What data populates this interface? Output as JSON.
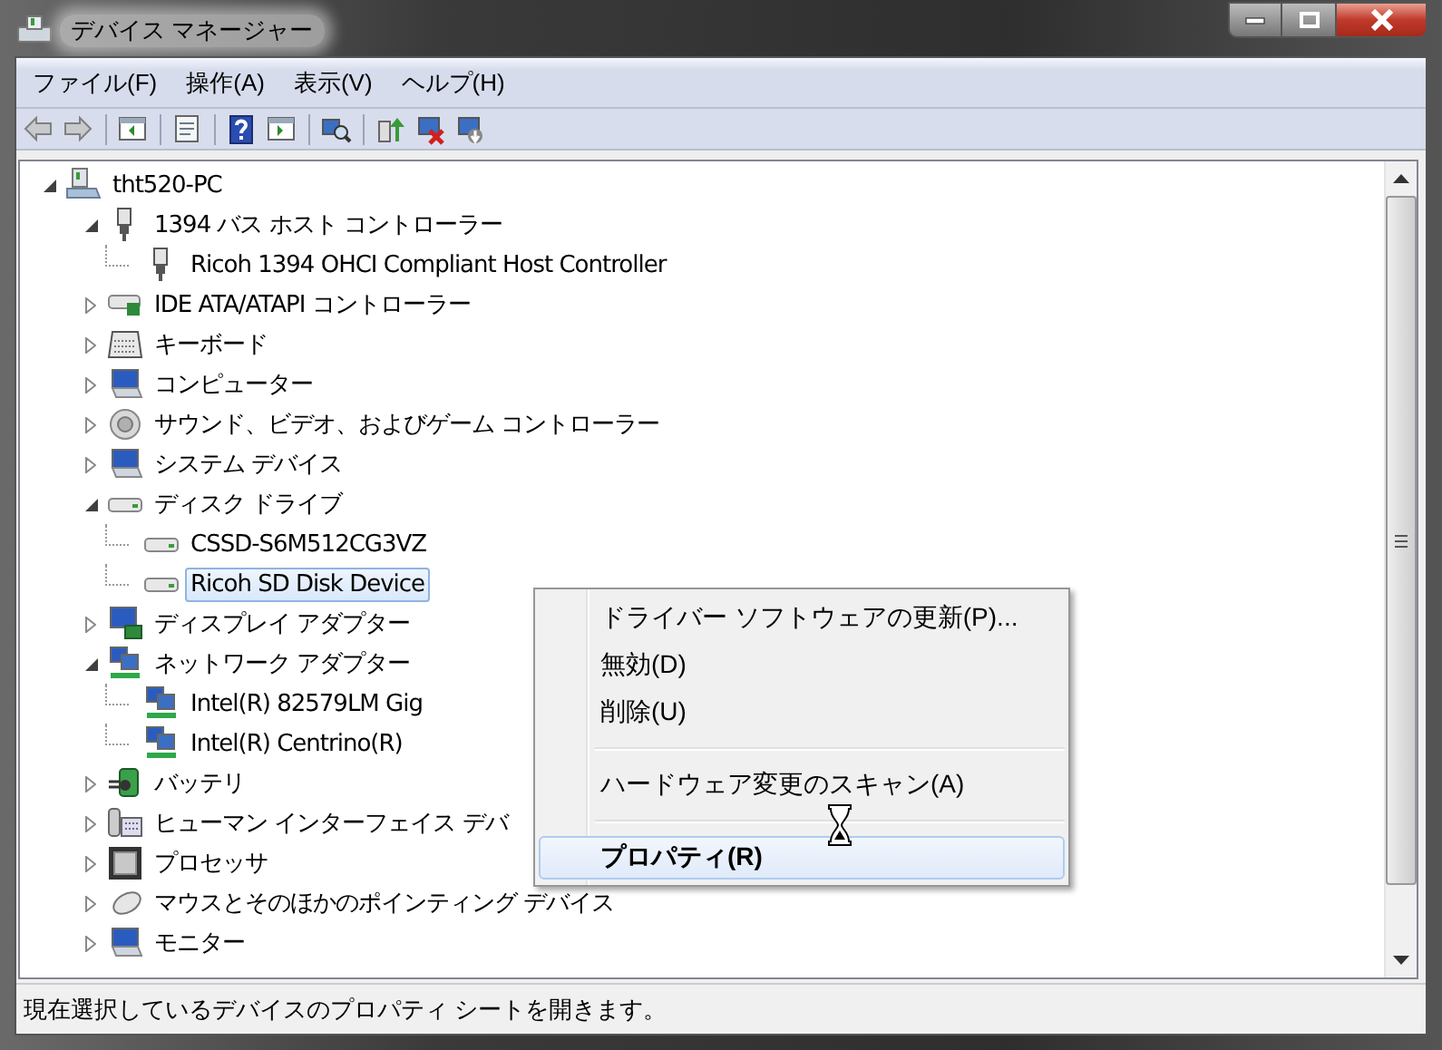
{
  "window": {
    "title": "デバイス マネージャー"
  },
  "menu_bar": [
    {
      "label": "ファイル(F)"
    },
    {
      "label": "操作(A)"
    },
    {
      "label": "表示(V)"
    },
    {
      "label": "ヘルプ(H)"
    }
  ],
  "toolbar": [
    {
      "kind": "back",
      "disabled": true
    },
    {
      "kind": "forward",
      "disabled": true
    },
    {
      "kind": "separator"
    },
    {
      "kind": "console-tree",
      "disabled": false
    },
    {
      "kind": "separator"
    },
    {
      "kind": "properties",
      "disabled": false
    },
    {
      "kind": "separator"
    },
    {
      "kind": "help",
      "disabled": false
    },
    {
      "kind": "action-pane",
      "disabled": false
    },
    {
      "kind": "separator"
    },
    {
      "kind": "scan",
      "disabled": false
    },
    {
      "kind": "separator"
    },
    {
      "kind": "update",
      "disabled": false
    },
    {
      "kind": "disable",
      "disabled": false
    },
    {
      "kind": "uninstall",
      "disabled": false
    }
  ],
  "tree": {
    "label": "tht520-PC",
    "kind": "computer",
    "expanded": true,
    "selected": false,
    "children": [
      {
        "label": "1394 バス ホスト コントローラー",
        "kind": "plug",
        "expanded": true,
        "selected": false,
        "children": [
          {
            "label": "Ricoh 1394 OHCI Compliant Host Controller",
            "kind": "plug",
            "selected": false
          }
        ]
      },
      {
        "label": "IDE ATA/ATAPI コントローラー",
        "kind": "ide",
        "expanded": false,
        "selected": false
      },
      {
        "label": "キーボード",
        "kind": "keyboard",
        "expanded": false,
        "selected": false
      },
      {
        "label": "コンピューター",
        "kind": "monitor",
        "expanded": false,
        "selected": false
      },
      {
        "label": "サウンド、ビデオ、およびゲーム コントローラー",
        "kind": "speaker",
        "expanded": false,
        "selected": false
      },
      {
        "label": "システム デバイス",
        "kind": "monitor",
        "expanded": false,
        "selected": false
      },
      {
        "label": "ディスク ドライブ",
        "kind": "disk",
        "expanded": true,
        "selected": false,
        "children": [
          {
            "label": "CSSD-S6M512CG3VZ",
            "kind": "disk",
            "selected": false
          },
          {
            "label": "Ricoh SD Disk Device",
            "kind": "disk",
            "selected": true
          }
        ]
      },
      {
        "label": "ディスプレイ アダプター",
        "kind": "display",
        "expanded": false,
        "selected": false
      },
      {
        "label": "ネットワーク アダプター",
        "kind": "network",
        "expanded": true,
        "selected": false,
        "children": [
          {
            "label": "Intel(R) 82579LM Gig",
            "kind": "network",
            "selected": false
          },
          {
            "label": "Intel(R) Centrino(R)",
            "kind": "network",
            "selected": false
          }
        ]
      },
      {
        "label": "バッテリ",
        "kind": "battery",
        "expanded": false,
        "selected": false
      },
      {
        "label": "ヒューマン インターフェイス デバ",
        "kind": "hid",
        "expanded": false,
        "selected": false
      },
      {
        "label": "プロセッサ",
        "kind": "processor",
        "expanded": false,
        "selected": false
      },
      {
        "label": "マウスとそのほかのポインティング デバイス",
        "kind": "mouse",
        "expanded": false,
        "selected": false
      },
      {
        "label": "モニター",
        "kind": "monitor",
        "expanded": false,
        "selected": false
      }
    ]
  },
  "context_menu": {
    "groups": [
      [
        {
          "label": "ドライバー ソフトウェアの更新(P)...",
          "default": false,
          "highlighted": false
        },
        {
          "label": "無効(D)",
          "default": false,
          "highlighted": false
        },
        {
          "label": "削除(U)",
          "default": false,
          "highlighted": false
        }
      ],
      [
        {
          "label": "ハードウェア変更のスキャン(A)",
          "default": false,
          "highlighted": false
        }
      ],
      [
        {
          "label": "プロパティ(R)",
          "default": true,
          "highlighted": true
        }
      ]
    ]
  },
  "status_bar": "現在選択しているデバイスのプロパティ シートを開きます。"
}
